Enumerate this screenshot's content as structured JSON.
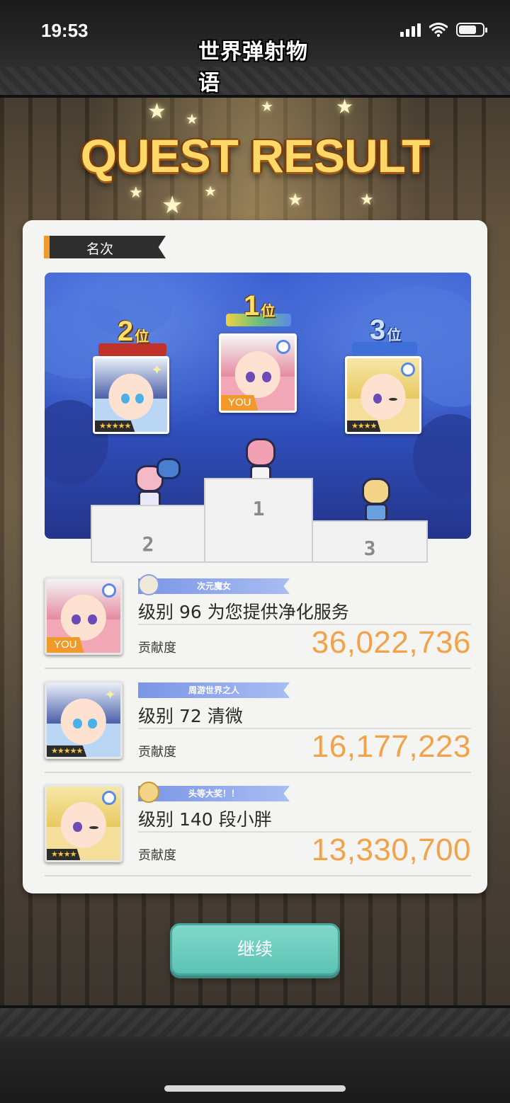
{
  "status_bar": {
    "time": "19:53"
  },
  "header": {
    "game_logo": "世界弹射物语"
  },
  "result": {
    "title": "QUEST RESULT",
    "section_label": "名次",
    "podium": {
      "first": {
        "rank_num": "1",
        "rank_suffix": "位",
        "podium_label": "1",
        "you": "YOU"
      },
      "second": {
        "rank_num": "2",
        "rank_suffix": "位",
        "podium_label": "2",
        "stars": "★★★★★"
      },
      "third": {
        "rank_num": "3",
        "rank_suffix": "位",
        "podium_label": "3",
        "stars": "★★★★"
      }
    },
    "contribution_label": "贡献度",
    "rows": [
      {
        "title": "次元魔女",
        "name": "级别 96 为您提供净化服务",
        "contribution": "36,022,736",
        "you": "YOU"
      },
      {
        "title": "周游世界之人",
        "name": "级别 72 清微",
        "contribution": "16,177,223",
        "stars": "★★★★★"
      },
      {
        "title": "头等大奖！！",
        "name": "级别 140 段小胖",
        "contribution": "13,330,700",
        "stars": "★★★★"
      }
    ],
    "continue_label": "继续"
  },
  "colors": {
    "accent_orange": "#f09a2c",
    "contribution_orange": "#f3a24a",
    "button_teal": "#5cc3b4",
    "title_gold": "#ffd86a",
    "podium_blue": "#3152c0"
  },
  "icons": [
    "signal-icon",
    "wifi-icon",
    "battery-icon",
    "star-icon",
    "ring-icon",
    "sparkle-icon"
  ]
}
